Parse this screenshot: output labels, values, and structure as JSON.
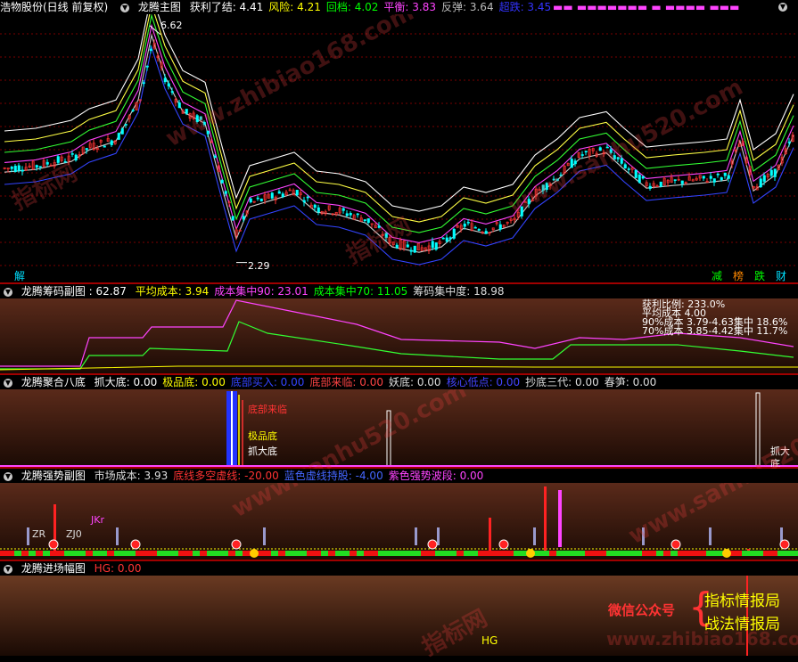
{
  "main": {
    "stock": "浩物股份(日线 前复权)",
    "indicator": "龙腾主图",
    "items": [
      {
        "label": "获利了结:",
        "value": "4.41",
        "color": "#ffffff"
      },
      {
        "label": "风险:",
        "value": "4.21",
        "color": "#ffff00"
      },
      {
        "label": "回档:",
        "value": "4.02",
        "color": "#00ff00"
      },
      {
        "label": "平衡:",
        "value": "3.83",
        "color": "#ff44ff"
      },
      {
        "label": "反弹:",
        "value": "3.64",
        "color": "#bbbbbb"
      },
      {
        "label": "超跌:",
        "value": "3.45",
        "color": "#3333ff"
      }
    ],
    "high_label": "6.62",
    "low_label": "2.29",
    "tag_left": "解",
    "tags_right": [
      "减",
      "榜",
      "跌",
      "财"
    ]
  },
  "chip": {
    "name": "龙腾筹码副图",
    "value": ": 62.87",
    "items": [
      {
        "label": "平均成本:",
        "value": "3.94",
        "color": "#ffff00"
      },
      {
        "label": "成本集中90:",
        "value": "23.01",
        "color": "#ff44ff"
      },
      {
        "label": "成本集中70:",
        "value": "11.05",
        "color": "#00ff00"
      },
      {
        "label": "筹码集中度:",
        "value": "18.98",
        "color": "#dddddd"
      }
    ],
    "info": [
      "获利比例: 233.0%",
      "平均成本 4.00",
      "90%成本 3.79-4.63集中 18.6%",
      "70%成本 3.85-4.42集中 11.7%"
    ]
  },
  "eight": {
    "name": "龙腾聚合八底",
    "items": [
      {
        "label": "抓大底:",
        "value": "0.00",
        "color": "#ffffff"
      },
      {
        "label": "极品底:",
        "value": "0.00",
        "color": "#ffff00"
      },
      {
        "label": "底部买入:",
        "value": "0.00",
        "color": "#3344ff"
      },
      {
        "label": "底部来临:",
        "value": "0.00",
        "color": "#ff4444"
      },
      {
        "label": "妖底:",
        "value": "0.00",
        "color": "#dddddd"
      },
      {
        "label": "核心低点:",
        "value": "0.00",
        "color": "#4444ff"
      },
      {
        "label": "抄底三代:",
        "value": "0.00",
        "color": "#dddddd"
      },
      {
        "label": "春笋:",
        "value": "0.00",
        "color": "#dddddd"
      }
    ],
    "markers": [
      "底部来临",
      "极品底",
      "抓大底"
    ],
    "right_marker": "抓大底"
  },
  "strong": {
    "name": "龙腾强势副图",
    "items": [
      {
        "label": "市场成本:",
        "value": "3.93",
        "color": "#dddddd"
      },
      {
        "label": "底线多空虚线:",
        "value": "-20.00",
        "color": "#ff3333"
      },
      {
        "label": "蓝色虚线持股:",
        "value": "-4.00",
        "color": "#4466ff"
      },
      {
        "label": "紫色强势波段:",
        "value": "0.00",
        "color": "#ff44ff"
      }
    ],
    "labels": [
      "ZR",
      "ZJ0",
      "JKr"
    ]
  },
  "entry": {
    "name": "龙腾进场幅图",
    "items": [
      {
        "label": "HG:",
        "value": "0.00",
        "color": "#ff3333"
      }
    ],
    "hg_label": "HG",
    "brand_prefix": "微信公众号",
    "brand_lines": [
      "指标情报局",
      "战法情报局"
    ]
  },
  "watermarks": [
    "指标网",
    "www.zhibiao168.com",
    "www.sanhu520.com"
  ],
  "chart_data": {
    "type": "line",
    "title": "龙腾主图",
    "price_range": [
      2.29,
      6.62
    ],
    "band_levels": [
      {
        "name": "获利了结",
        "value": 4.41
      },
      {
        "name": "风险",
        "value": 4.21
      },
      {
        "name": "回档",
        "value": 4.02
      },
      {
        "name": "平衡",
        "value": 3.83
      },
      {
        "name": "反弹",
        "value": 3.64
      },
      {
        "name": "超跌",
        "value": 3.45
      }
    ],
    "chip_series": [
      "成本集中90",
      "成本集中70",
      "平均成本"
    ]
  }
}
